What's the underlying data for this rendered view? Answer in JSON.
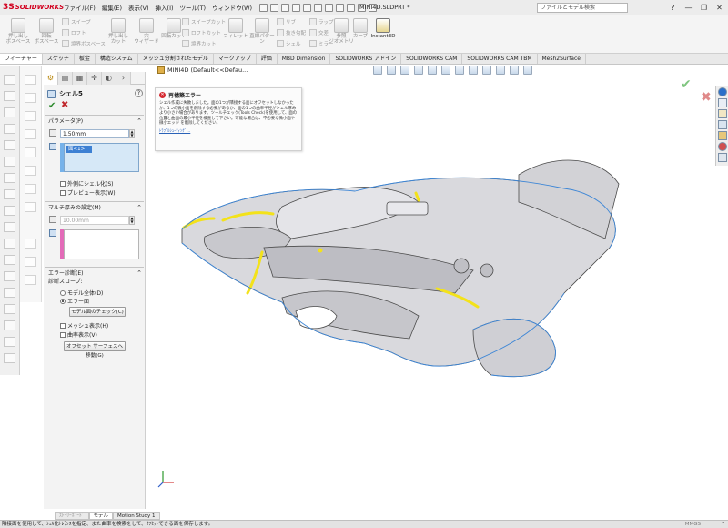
{
  "app": {
    "logo_mark": "3S",
    "logo_text": "SOLIDWORKS",
    "menus": [
      "ファイル(F)",
      "編集(E)",
      "表示(V)",
      "挿入(I)",
      "ツール(T)",
      "ウィンドウ(W)"
    ],
    "document_title": "MINI4D.SLDPRT *",
    "search_placeholder": "ファイルとモデル検索",
    "window_controls": [
      "?",
      "—",
      "❐",
      "✕"
    ]
  },
  "ribbon": {
    "buttons": [
      {
        "label": "押し出し\nボスベース",
        "icon": "extrude-boss-icon"
      },
      {
        "label": "回転\nボスベース",
        "icon": "revolve-boss-icon"
      },
      {
        "label": "押し出し\nカット",
        "icon": "extrude-cut-icon"
      },
      {
        "label": "穴\nウィザード",
        "icon": "hole-wizard-icon"
      },
      {
        "label": "回転カット",
        "icon": "revolve-cut-icon"
      },
      {
        "label": "フィレット",
        "icon": "fillet-icon"
      },
      {
        "label": "直線パターン",
        "icon": "linear-pattern-icon"
      },
      {
        "label": "参照\nジオメトリ",
        "icon": "reference-geometry-icon"
      },
      {
        "label": "カーブ",
        "icon": "curves-icon"
      },
      {
        "label": "Instant3D",
        "icon": "instant3d-icon"
      }
    ],
    "small_items": [
      "スイープ",
      "ロフト",
      "境界ボスベース",
      "スイープカット",
      "ロフトカット",
      "境界カット",
      "リブ",
      "抜き勾配",
      "シェル",
      "ラップ",
      "交差",
      "ミラー"
    ]
  },
  "tabs": [
    "フィーチャー",
    "スケッチ",
    "板金",
    "構造システム",
    "メッシュ分割されたモデル",
    "マークアップ",
    "評価",
    "MBD Dimension",
    "SOLIDWORKS アドイン",
    "SOLIDWORKS CAM",
    "SOLIDWORKS CAM TBM",
    "Mesh2Surface"
  ],
  "property_manager": {
    "title": "シェル5",
    "help": "?",
    "ok": "✔",
    "cancel": "✖",
    "params_header": "パラメータ(P)",
    "thickness_value": "1.50mm",
    "faces_selected": "面<1>",
    "shell_outward": "外側にシェル化(S)",
    "show_preview": "プレビュー表示(W)",
    "multi_header": "マルチ厚みの設定(M)",
    "multi_thickness_value": "10.00mm",
    "error_header": "エラー診断(E)",
    "diag_scope_label": "診断スコープ:",
    "scope_whole_model": "モデル全体(D)",
    "scope_error_face": "エラー面",
    "check_model_button": "モデル面のチェック(C)",
    "show_mesh": "メッシュ表示(H)",
    "show_curvature": "曲率表示(V)",
    "offset_button": "オフセット サーフェスへ移動(G)"
  },
  "graphics": {
    "tree_path": "MINI4D  (Default<<Defau...",
    "error_title": "再構築エラー",
    "error_body": "シェル作成に失敗しました。面の1つが隣接する面にオフセットしなかったか、1つの微小面を削除する必要があるか、面の1つの曲率半径がシェル厚みより小さい場合があります。ツールチェック(Tools Check)を使用して、面の位置と曲面の最小半径を検査して下さい。可能な場合は、不必要な微小面や微小エッジ を削除してください。",
    "error_link": "ﾄﾗﾌﾞﾙｼｭｰﾃｨﾝｸﾞ...",
    "confirm_ok": "✔",
    "confirm_cancel": "✖"
  },
  "bottom_tabs": [
    "ｽﾄｰﾘｰﾎﾞｰﾄﾞ",
    "モデル",
    "Motion Study 1"
  ],
  "status": {
    "message": "隣接面を使用して、ｼｪﾙ化ﾄﾚﾗﾝｽを指定、また曲率を検索をして、ｵﾌｾｯﾄできる面を保存します。",
    "units": "MMGS",
    "help": "?"
  },
  "colors": {
    "accent_blue": "#3d80d3",
    "error_highlight": "#f3e21a",
    "model_edge": "#3d86d6",
    "brand_red": "#d2001e"
  }
}
